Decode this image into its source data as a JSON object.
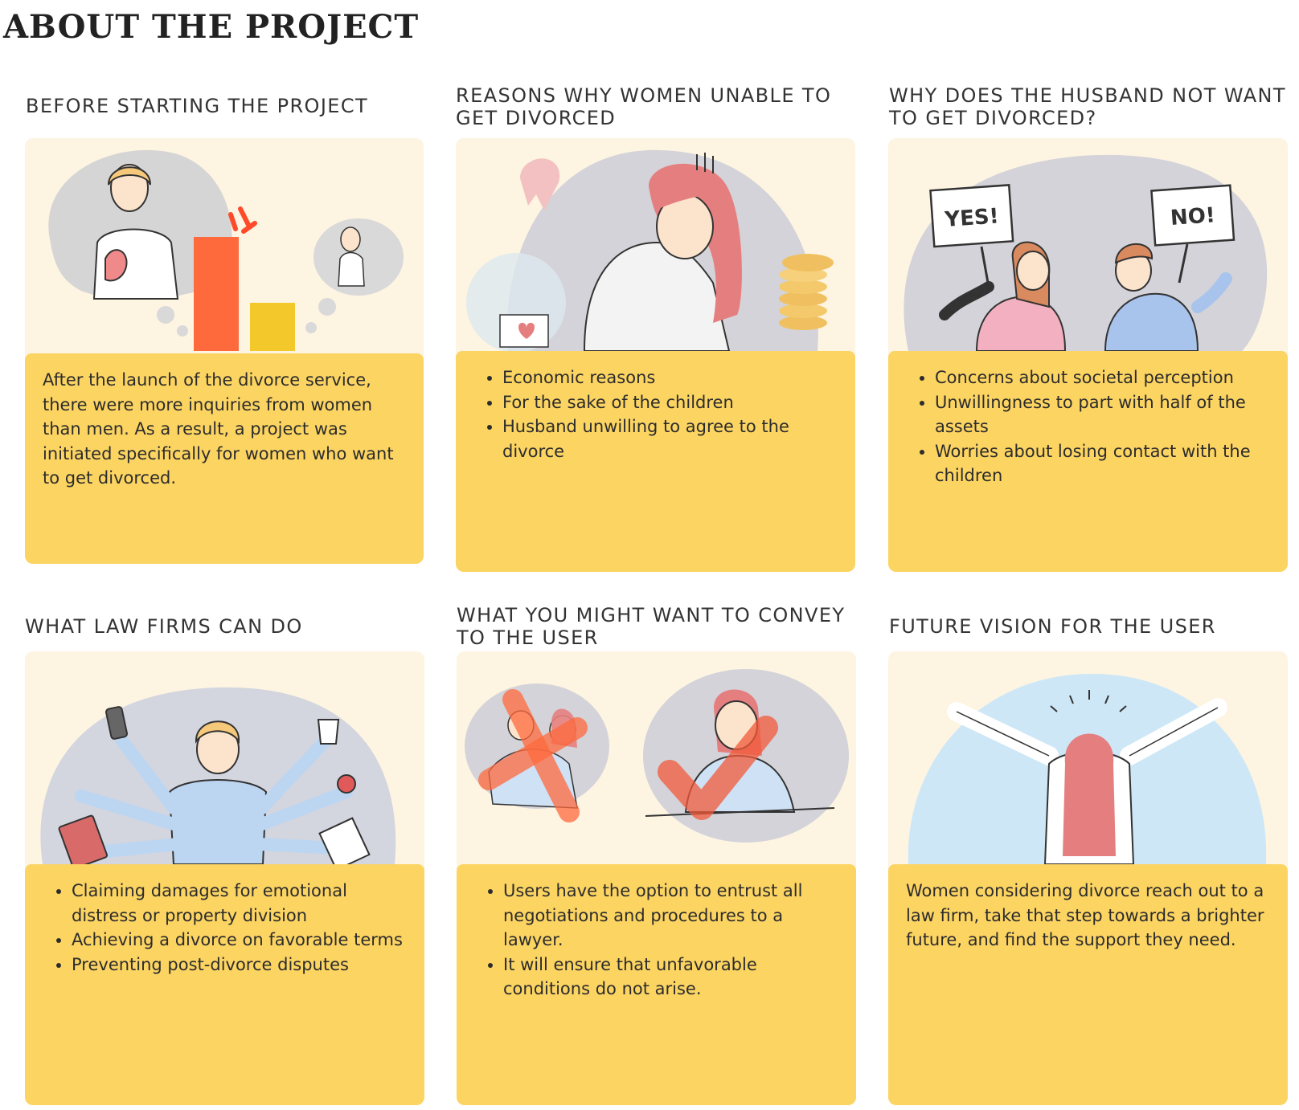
{
  "page": {
    "title": "ABOUT THE PROJECT"
  },
  "cards": [
    {
      "title": "BEFORE STARTING THE PROJECT",
      "paragraph": "After the launch of the divorce service, there were more inquiries from women than men. As a result, a project was initiated specifically for women who want to get divorced."
    },
    {
      "title": "REASONS WHY WOMEN UNABLE TO GET DIVORCED",
      "items": [
        "Economic reasons",
        "For the sake of the children",
        "Husband unwilling to agree to the divorce"
      ]
    },
    {
      "title": "WHY DOES THE HUSBAND NOT WANT TO GET DIVORCED?",
      "sign_yes": "YES!",
      "sign_no": "NO!",
      "items": [
        "Concerns about societal perception",
        "Unwillingness to part with half of the assets",
        "Worries about losing contact with the children"
      ]
    },
    {
      "title": "WHAT LAW FIRMS CAN DO",
      "items": [
        "Claiming damages for emotional distress or property division",
        "Achieving a divorce on favorable terms",
        "Preventing post-divorce disputes"
      ]
    },
    {
      "title": "WHAT YOU MIGHT WANT TO CONVEY TO THE USER",
      "items": [
        "Users have the option to entrust all negotiations and procedures to a lawyer.",
        "It will ensure that unfavorable conditions do not arise."
      ]
    },
    {
      "title": "FUTURE VISION FOR THE USER",
      "paragraph": "Women considering divorce reach out to a law firm, take that step towards a brighter future, and find the support they need."
    }
  ],
  "colors": {
    "card_bg": "#fdf4e2",
    "text_panel": "#fcd462",
    "bar_orange": "#ff6a3d",
    "bar_yellow": "#f2c82a",
    "hair_red": "#e57f7f",
    "sky_blue": "#cde7f7"
  },
  "icons": [
    "broken-heart-icon",
    "coins-icon",
    "checkmark-icon",
    "coffee-cup-icon",
    "phone-icon",
    "apple-icon",
    "notebook-icon"
  ]
}
